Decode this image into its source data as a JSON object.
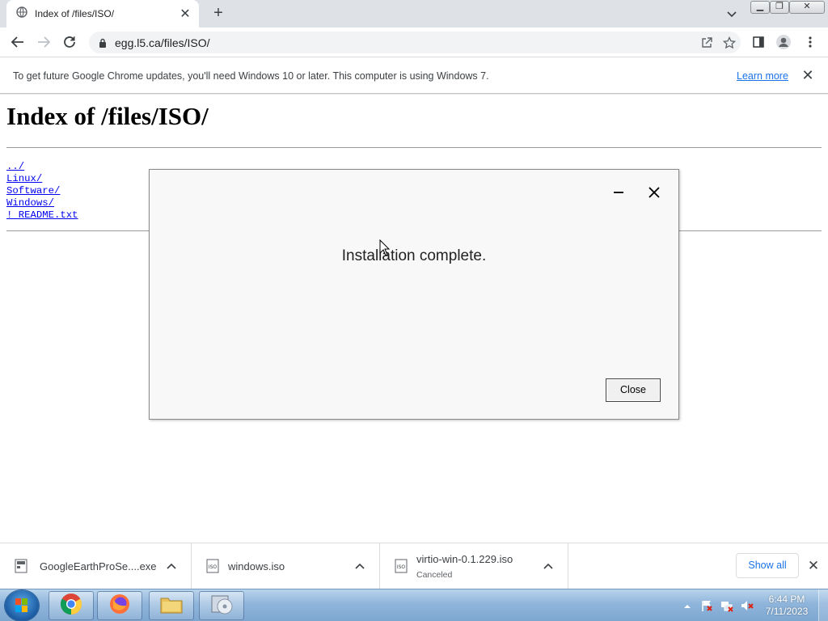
{
  "browser": {
    "tab_title": "Index of /files/ISO/",
    "url": "egg.l5.ca/files/ISO/",
    "infobar": {
      "message": "To get future Google Chrome updates, you'll need Windows 10 or later. This computer is using Windows 7.",
      "link": "Learn more"
    }
  },
  "page": {
    "heading": "Index of /files/ISO/",
    "entries": [
      "../",
      "Linux/",
      "Software/",
      "Windows/",
      "! README.txt"
    ]
  },
  "dialog": {
    "message": "Installation complete.",
    "close_label": "Close"
  },
  "downloads": {
    "items": [
      {
        "name": "GoogleEarthProSe....exe",
        "status": "",
        "icon": "exe-file-icon"
      },
      {
        "name": "windows.iso",
        "status": "",
        "icon": "iso-file-icon"
      },
      {
        "name": "virtio-win-0.1.229.iso",
        "status": "Canceled",
        "icon": "iso-file-icon"
      }
    ],
    "show_all": "Show all"
  },
  "taskbar": {
    "apps": [
      "chrome",
      "firefox",
      "file-explorer",
      "disc-installer"
    ],
    "time": "6:44 PM",
    "date": "7/11/2023"
  },
  "colors": {
    "tabstrip": "#dee1e6",
    "link": "#1a73e8",
    "page_link": "#0000ee",
    "taskbar": "#8fb5db"
  }
}
